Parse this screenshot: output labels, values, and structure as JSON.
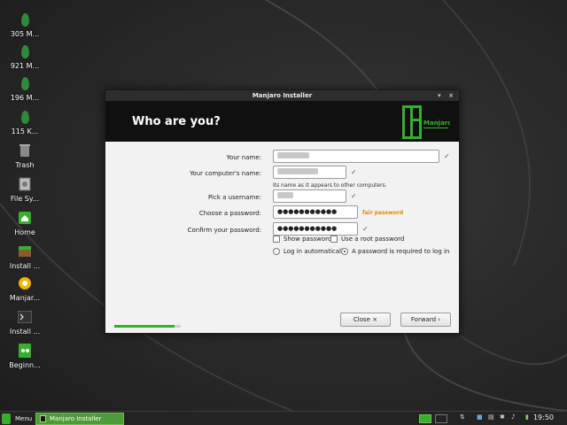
{
  "desktop": {
    "icons": [
      {
        "label": "305 M...",
        "icon": "drive-icon"
      },
      {
        "label": "921 M...",
        "icon": "drive-icon"
      },
      {
        "label": "196 M...",
        "icon": "drive-icon"
      },
      {
        "label": "115 K...",
        "icon": "drive-icon"
      },
      {
        "label": "Trash",
        "icon": "trash-icon"
      },
      {
        "label": "File Sy...",
        "icon": "filesystem-icon"
      },
      {
        "label": "Home",
        "icon": "home-icon"
      },
      {
        "label": "Install ...",
        "icon": "install-icon"
      },
      {
        "label": "Manjar...",
        "icon": "manjaro-icon"
      },
      {
        "label": "Install ...",
        "icon": "terminal-icon"
      },
      {
        "label": "Beginn...",
        "icon": "beginner-icon"
      }
    ]
  },
  "window": {
    "title": "Manjaro Installer",
    "controls": [
      "▾",
      "×"
    ],
    "header": "Who are you?",
    "logo_text": "Manjaro",
    "form": {
      "name_label": "Your name:",
      "computer_label": "Your computer's name:",
      "computer_hint": "Its name as it appears to other computers.",
      "username_label": "Pick a username:",
      "password_label": "Choose a password:",
      "password_value": "●●●●●●●●●●●",
      "password_strength": "fair password",
      "confirm_label": "Confirm your password:",
      "confirm_value": "●●●●●●●●●●●",
      "show_password": "Show password",
      "root_password": "Use a root password",
      "login_auto": "Log in automatically",
      "login_password": "A password is required to log in",
      "check_mark": "✓"
    },
    "progress": 0.9,
    "buttons": {
      "close": "Close ×",
      "forward": "Forward ›"
    }
  },
  "taskbar": {
    "menu_label": "Menu",
    "task_label": "Manjaro Installer",
    "clock": "19:50"
  },
  "colors": {
    "accent": "#35b02b",
    "warning": "#e08a00",
    "header_bg": "#101010"
  }
}
